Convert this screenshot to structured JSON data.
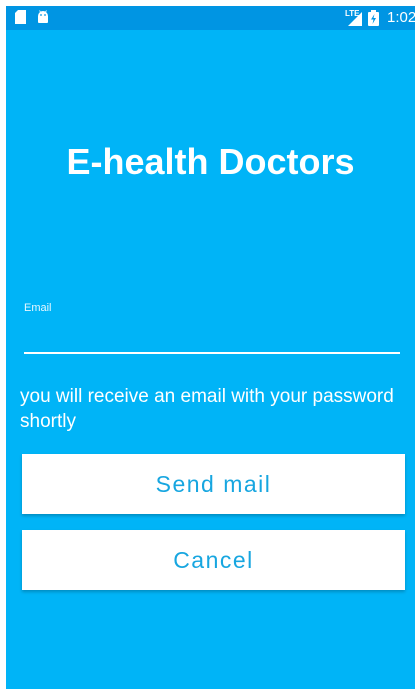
{
  "status_bar": {
    "time": "1:02",
    "network": "LTE",
    "icons": [
      "sd-card-icon",
      "android-icon",
      "signal-icon",
      "battery-icon"
    ]
  },
  "app": {
    "title": "E-health Doctors"
  },
  "form": {
    "email_label": "Email",
    "email_value": "",
    "info_text": "you will receive an email with your password shortly",
    "send_label": "Send mail",
    "cancel_label": "Cancel"
  },
  "colors": {
    "background": "#00b4f7",
    "status_bar": "#0095e3",
    "button_text": "#17a6e0",
    "button_bg": "#ffffff"
  }
}
